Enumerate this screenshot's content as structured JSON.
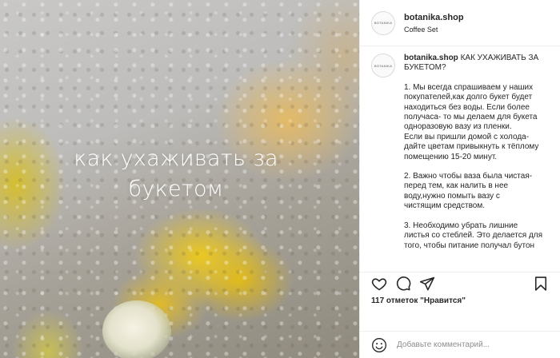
{
  "header": {
    "avatar_text": "BOTANIKA",
    "username": "botanika.shop",
    "location": "Coffee Set"
  },
  "media": {
    "overlay_line1": "как ухаживать за",
    "overlay_line2": "букетом"
  },
  "caption": {
    "avatar_text": "BOTANIKA",
    "username": "botanika.shop",
    "title": "КАК УХАЖИВАТЬ ЗА",
    "title_cont": "БУКЕТОМ?",
    "p1": [
      "1. Мы всегда спрашиваем у наших",
      "покупателей,как долго букет будет",
      "находиться без воды. Если более",
      "получаса- то мы делаем для букета",
      "одноразовую вазу из пленки.",
      "Если вы пришли домой с холода-",
      "дайте цветам привыкнуть к тёплому",
      "помещению 15-20 минут."
    ],
    "p2": [
      "2. Важно чтобы ваза была чистая-",
      "перед тем, как налить в нее",
      "воду,нужно помыть вазу с",
      "чистящим средством."
    ],
    "p3": [
      "3. Необходимо убрать лишние",
      "листья со стеблей. Это делается для",
      "того, чтобы питание получал бутон"
    ]
  },
  "actions": {
    "icons": [
      "heart-icon",
      "comment-icon",
      "share-icon",
      "bookmark-icon"
    ],
    "likes_count": "117 отметок",
    "likes_suffix": " \"Нравится\""
  },
  "comment_box": {
    "placeholder": "Добавьте комментарий..."
  }
}
